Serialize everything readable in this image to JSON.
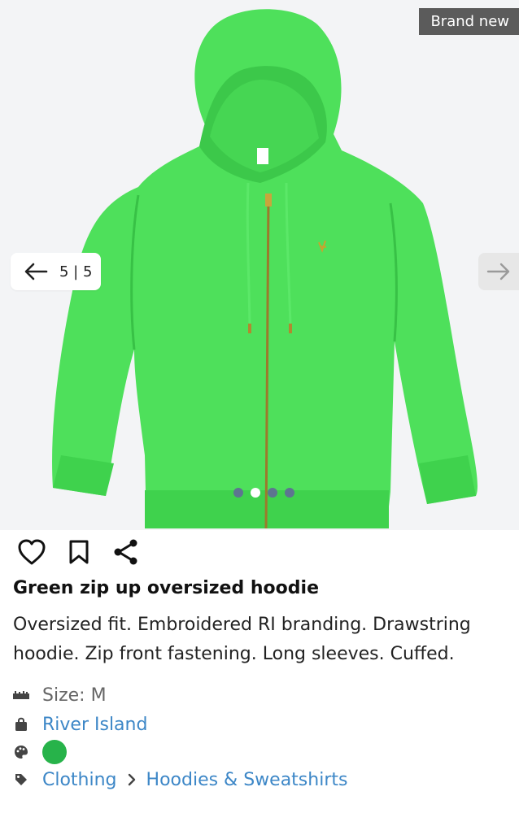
{
  "gallery": {
    "badge": "Brand new",
    "counter": "5 | 5",
    "image_subject": "green-zip-hoodie",
    "dots": [
      false,
      true,
      false,
      false
    ]
  },
  "actions": {
    "like_icon": "heart-icon",
    "save_icon": "bookmark-icon",
    "share_icon": "share-icon"
  },
  "product": {
    "title": "Green zip up oversized hoodie",
    "description": "Oversized fit. Embroidered RI branding. Drawstring hoodie. Zip front fastening. Long sleeves. Cuffed."
  },
  "details": {
    "size": "Size: M",
    "brand": "River Island",
    "color_hex": "#27b34a",
    "category": "Clothing",
    "subcategory": "Hoodies & Sweatshirts"
  },
  "colors": {
    "badge_bg": "#5b5b5b",
    "link": "#3d87c7",
    "hoodie": "#4ee05b",
    "dot": "#5d7590"
  }
}
